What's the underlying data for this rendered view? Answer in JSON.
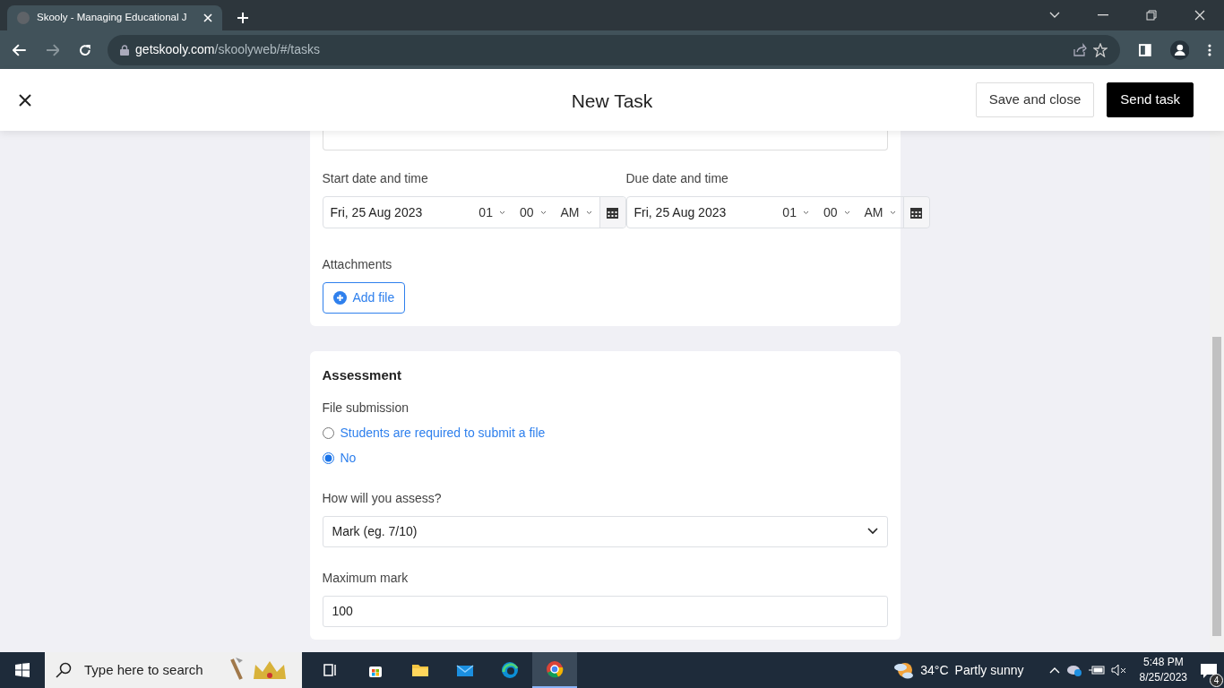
{
  "browser": {
    "tab_title": "Skooly - Managing Educational J",
    "url_host": "getskooly.com",
    "url_path": "/skoolyweb/#/tasks"
  },
  "header": {
    "title": "New Task",
    "buttons": [
      {
        "label": "Save and close",
        "kind": "outline"
      },
      {
        "label": "Send task",
        "kind": "primary"
      }
    ]
  },
  "task_card": {
    "datetimes": [
      {
        "label": "Start date and time",
        "date": "Fri, 25 Aug 2023",
        "hour": "01",
        "minute": "00",
        "period": "AM"
      },
      {
        "label": "Due date and time",
        "date": "Fri, 25 Aug 2023",
        "hour": "01",
        "minute": "00",
        "period": "AM"
      }
    ],
    "attachments_label": "Attachments",
    "add_file": "Add file"
  },
  "assessment": {
    "title": "Assessment",
    "file_submission_label": "File submission",
    "options": [
      {
        "label": "Students are required to submit a file",
        "selected": false
      },
      {
        "label": "No",
        "selected": true
      }
    ],
    "assess_label": "How will you assess?",
    "assess_value": "Mark (eg. 7/10)",
    "max_mark_label": "Maximum mark",
    "max_mark_value": "100"
  },
  "taskbar": {
    "search_placeholder": "Type here to search",
    "temperature": "34°C",
    "weather": "Partly sunny",
    "time": "5:48 PM",
    "date": "8/25/2023",
    "notifications": "4"
  }
}
